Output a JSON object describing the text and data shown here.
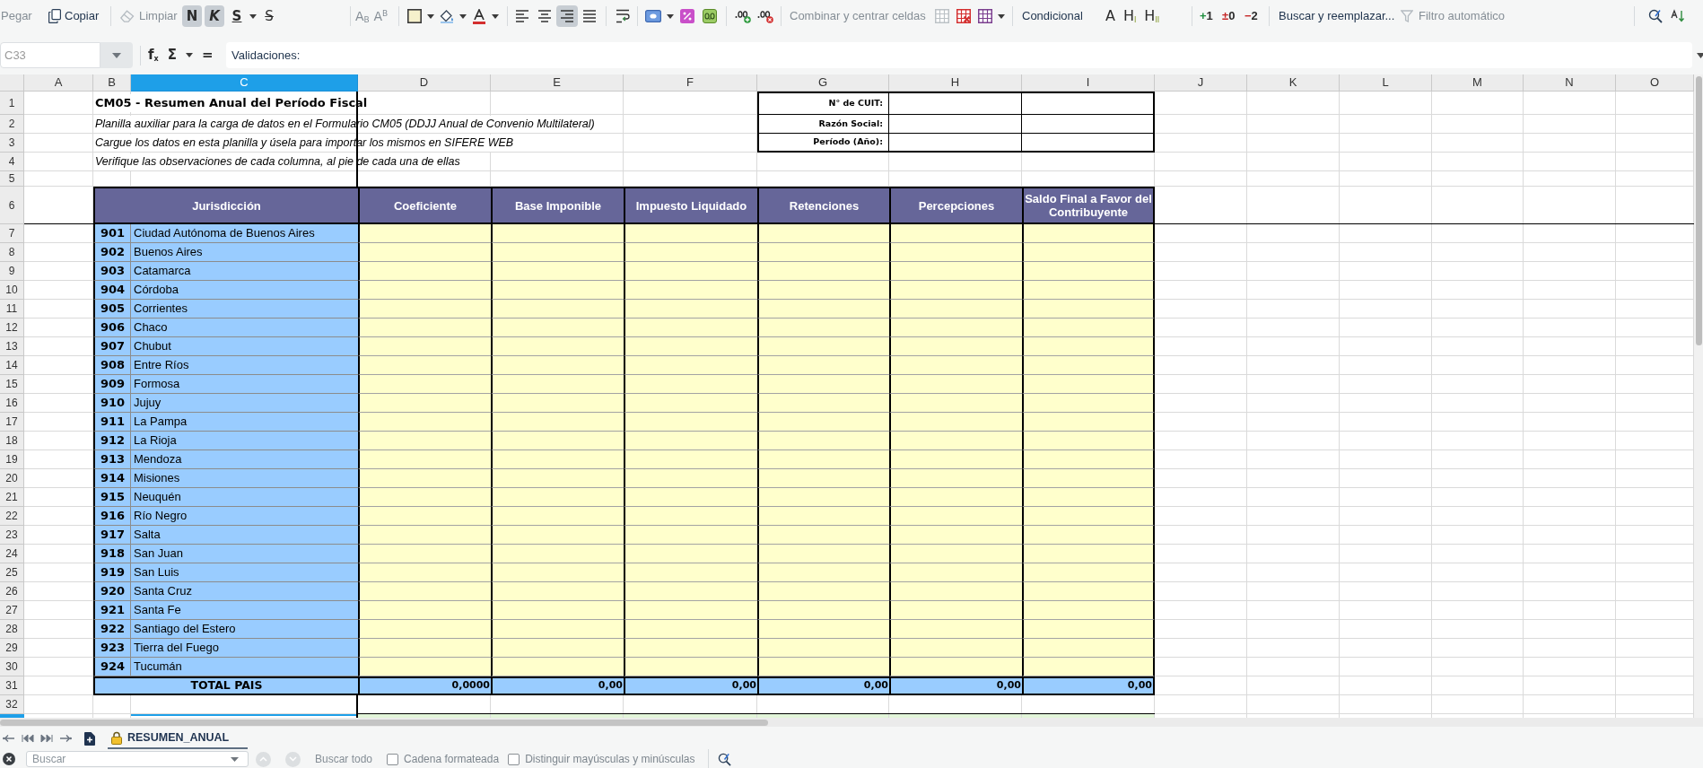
{
  "toolbar": {
    "paste": {
      "label": "Pegar",
      "disabled": true
    },
    "copy": {
      "label": "Copiar",
      "disabled": false
    },
    "clear": {
      "label": "Limpiar",
      "disabled": true
    },
    "text_style": [
      {
        "kind": "bold",
        "label": "N",
        "selected": true
      },
      {
        "kind": "italic",
        "label": "K",
        "selected": true
      },
      {
        "kind": "underline",
        "label": "S",
        "selected": false
      },
      {
        "kind": "strikethrough",
        "label": "S",
        "selected": false
      }
    ],
    "script": [
      {
        "label": "A$_{B}$",
        "disabled": true
      },
      {
        "label": "A$^{B}$",
        "disabled": true
      }
    ],
    "alignment": [
      {
        "kind": "left",
        "selected": false
      },
      {
        "kind": "center",
        "selected": false
      },
      {
        "kind": "right",
        "selected": true
      },
      {
        "kind": "justify",
        "selected": false
      }
    ],
    "merge": {
      "label": "Combinar y centrar celdas",
      "disabled": true
    },
    "conditional": {
      "label": "Condicional"
    },
    "styles": [
      "A",
      "H$_{I}$",
      "H$_{II}$"
    ],
    "outline": [
      {
        "sign": "+",
        "number": "1",
        "color": "#1e8e3e"
      },
      {
        "sign": "±",
        "number": "0",
        "color": "#c62828"
      },
      {
        "sign": "−",
        "number": "2",
        "color": "#c62828"
      }
    ],
    "find_replace": {
      "label": "Buscar y reemplazar..."
    },
    "autofilter": {
      "label": "Filtro automático",
      "disabled": true
    }
  },
  "formula_bar": {
    "cell_reference": "C33",
    "buttons": [
      {
        "label": "f$_{x}$",
        "menu": false
      },
      {
        "label": "Σ",
        "menu": true
      },
      {
        "label": "=",
        "menu": false
      }
    ],
    "content": "Validaciones:"
  },
  "sheet": {
    "columns": [
      {
        "label": "A",
        "selected": false
      },
      {
        "label": "B",
        "selected": false
      },
      {
        "label": "C",
        "selected": true
      },
      {
        "label": "D",
        "selected": false
      },
      {
        "label": "E",
        "selected": false
      },
      {
        "label": "F",
        "selected": false
      },
      {
        "label": "G",
        "selected": false
      },
      {
        "label": "H",
        "selected": false
      },
      {
        "label": "I",
        "selected": false
      },
      {
        "label": "J",
        "selected": false
      },
      {
        "label": "K",
        "selected": false
      },
      {
        "label": "L",
        "selected": false
      },
      {
        "label": "M",
        "selected": false
      },
      {
        "label": "N",
        "selected": false
      },
      {
        "label": "O",
        "selected": false
      }
    ],
    "rows": [
      "1",
      "2",
      "3",
      "4",
      "5",
      "6",
      "7",
      "8",
      "9",
      "10",
      "11",
      "12",
      "13",
      "14",
      "15",
      "16",
      "17",
      "18",
      "19",
      "20",
      "21",
      "22",
      "23",
      "24",
      "25",
      "26",
      "27",
      "28",
      "29",
      "30",
      "31",
      "32"
    ],
    "next_row": {
      "selected": true
    },
    "title": "CM05 - Resumen Anual del Período Fiscal",
    "notes": [
      "Planilla auxiliar para la carga de datos en el Formulario CM05 (DDJJ Anual de Convenio Multilateral)",
      "Cargue los datos en esta planilla y úsela para importar los mismos en SIFERE WEB",
      "Verifique las observaciones de cada columna, al pie de cada una de ellas"
    ],
    "taxpayer_fields": [
      "N° de CUIT:",
      "Razón Social:",
      "Período (Año):"
    ],
    "table": {
      "headers": [
        "Jurisdicción",
        "Coeficiente",
        "Base Imponible",
        "Impuesto Liquidado",
        "Retenciones",
        "Percepciones",
        "Saldo Final a Favor del Contribuyente"
      ],
      "rows": [
        {
          "code": "901",
          "name": "Ciudad Autónoma de Buenos Aires"
        },
        {
          "code": "902",
          "name": "Buenos Aires"
        },
        {
          "code": "903",
          "name": "Catamarca"
        },
        {
          "code": "904",
          "name": "Córdoba"
        },
        {
          "code": "905",
          "name": "Corrientes"
        },
        {
          "code": "906",
          "name": "Chaco"
        },
        {
          "code": "907",
          "name": "Chubut"
        },
        {
          "code": "908",
          "name": "Entre Ríos"
        },
        {
          "code": "909",
          "name": "Formosa"
        },
        {
          "code": "910",
          "name": "Jujuy"
        },
        {
          "code": "911",
          "name": "La Pampa"
        },
        {
          "code": "912",
          "name": "La Rioja"
        },
        {
          "code": "913",
          "name": "Mendoza"
        },
        {
          "code": "914",
          "name": "Misiones"
        },
        {
          "code": "915",
          "name": "Neuquén"
        },
        {
          "code": "916",
          "name": "Río Negro"
        },
        {
          "code": "917",
          "name": "Salta"
        },
        {
          "code": "918",
          "name": "San Juan"
        },
        {
          "code": "919",
          "name": "San Luis"
        },
        {
          "code": "920",
          "name": "Santa Cruz"
        },
        {
          "code": "921",
          "name": "Santa Fe"
        },
        {
          "code": "922",
          "name": "Santiago del Estero"
        },
        {
          "code": "923",
          "name": "Tierra del Fuego"
        },
        {
          "code": "924",
          "name": "Tucumán"
        }
      ],
      "total": {
        "label": "TOTAL PAIS",
        "values": [
          "0,0000",
          "0,00",
          "0,00",
          "0,00",
          "0,00",
          "0,00"
        ]
      }
    }
  },
  "sheet_tabs": [
    {
      "label": "RESUMEN_ANUAL",
      "selected": true,
      "protected": true
    }
  ],
  "find_bar": {
    "placeholder": "Buscar",
    "previous": {
      "disabled": true
    },
    "next": {
      "disabled": true
    },
    "find_all": {
      "label": "Buscar todo",
      "disabled": true
    },
    "options": [
      {
        "label": "Cadena formateada",
        "checked": false
      },
      {
        "label": "Distinguir mayúsculas y minúsculas",
        "checked": false
      }
    ]
  }
}
